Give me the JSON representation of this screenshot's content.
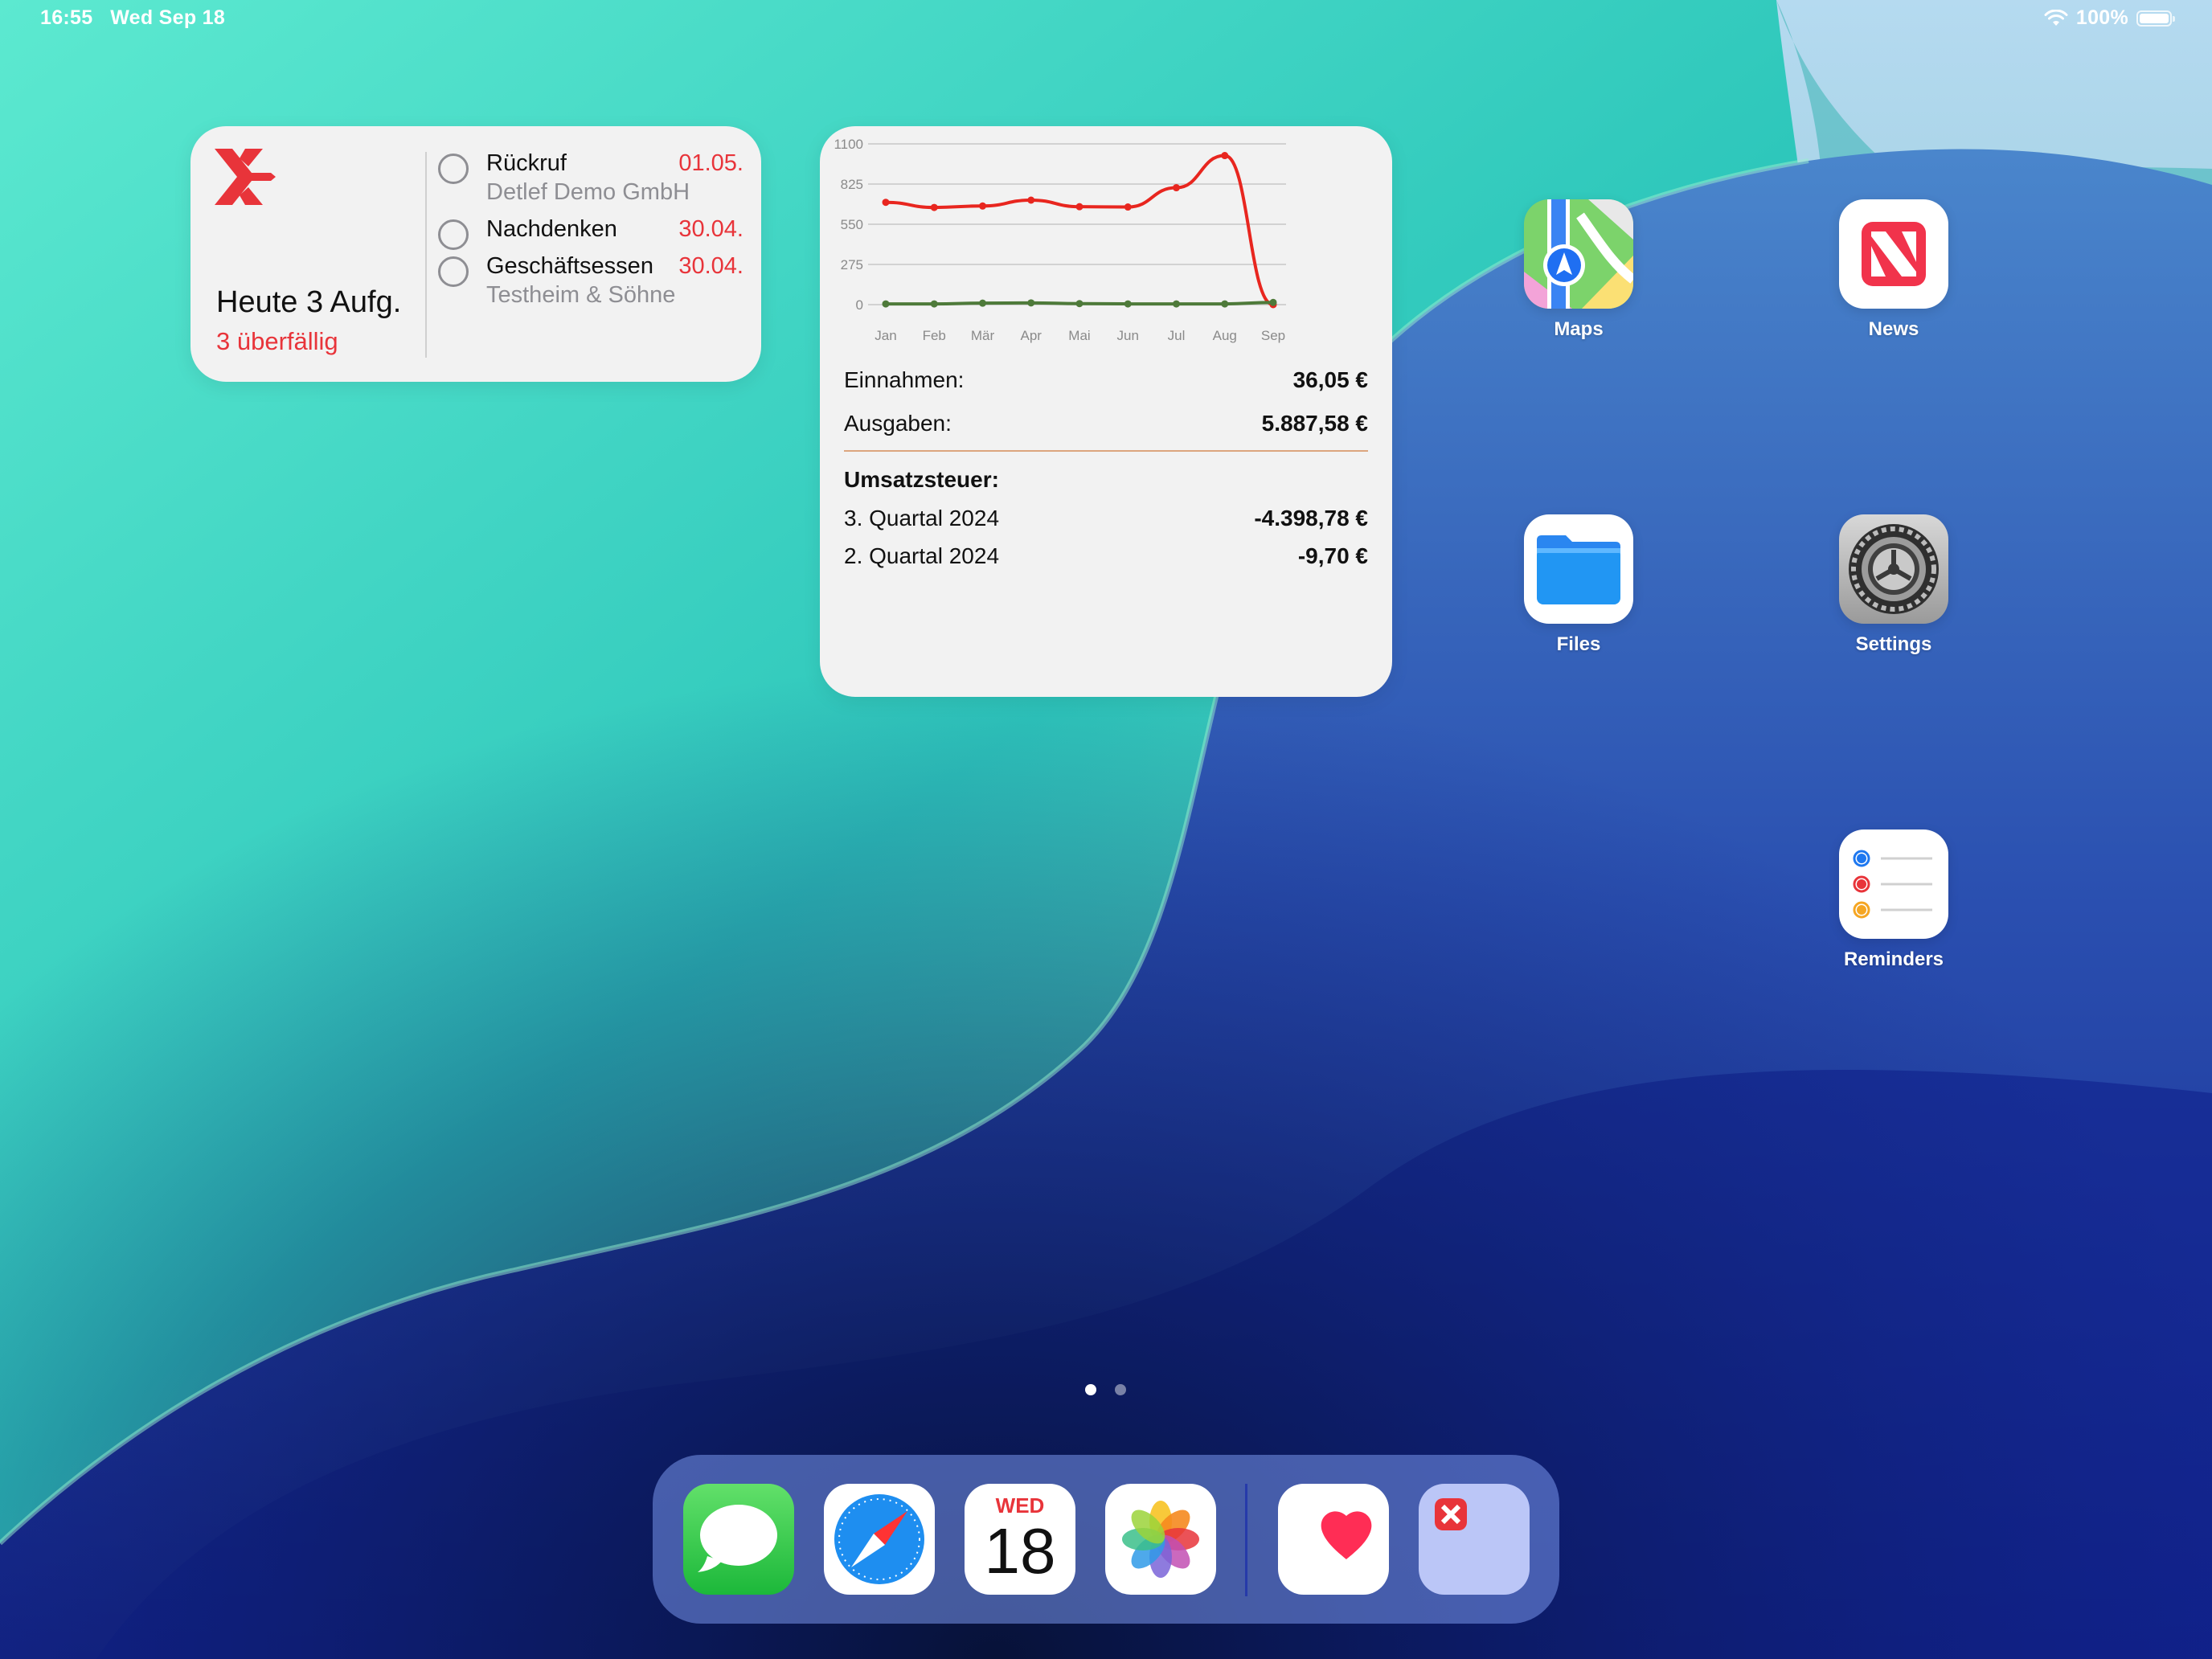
{
  "status_bar": {
    "time": "16:55",
    "date": "Wed Sep 18",
    "battery": "100%"
  },
  "task_widget": {
    "summary": "Heute 3 Aufg.",
    "overdue": "3 überfällig",
    "tasks": [
      {
        "title": "Rückruf",
        "date": "01.05.",
        "subtitle": "Detlef Demo GmbH"
      },
      {
        "title": "Nachdenken",
        "date": "30.04.",
        "subtitle": ""
      },
      {
        "title": "Geschäftsessen",
        "date": "30.04.",
        "subtitle": "Testheim & Söhne"
      }
    ]
  },
  "finance_widget": {
    "einnahmen_label": "Einnahmen:",
    "einnahmen_value": "36,05 €",
    "ausgaben_label": "Ausgaben:",
    "ausgaben_value": "5.887,58 €",
    "ust_heading": "Umsatzsteuer:",
    "quarters": [
      {
        "label": "3. Quartal 2024",
        "value": "-4.398,78 €"
      },
      {
        "label": "2. Quartal 2024",
        "value": "-9,70 €"
      }
    ]
  },
  "chart_data": {
    "type": "line",
    "categories": [
      "Jan",
      "Feb",
      "Mär",
      "Apr",
      "Mai",
      "Jun",
      "Jul",
      "Aug",
      "Sep"
    ],
    "yticks": [
      "1100",
      "825",
      "550",
      "275",
      "0"
    ],
    "ylim": [
      0,
      1100
    ],
    "grid": true,
    "series": [
      {
        "color": "#e8261f",
        "values": [
          700,
          665,
          675,
          715,
          670,
          668,
          800,
          1020,
          0
        ]
      },
      {
        "color": "#4e7a3a",
        "values": [
          5,
          5,
          10,
          12,
          7,
          5,
          5,
          5,
          15
        ]
      }
    ]
  },
  "apps": {
    "maps": "Maps",
    "news": "News",
    "files": "Files",
    "settings": "Settings",
    "reminders": "Reminders"
  },
  "calendar_icon": {
    "weekday": "WED",
    "day": "18"
  },
  "colors": {
    "accent_red": "#e8343a",
    "widget_bg": "#f2f2f2"
  }
}
